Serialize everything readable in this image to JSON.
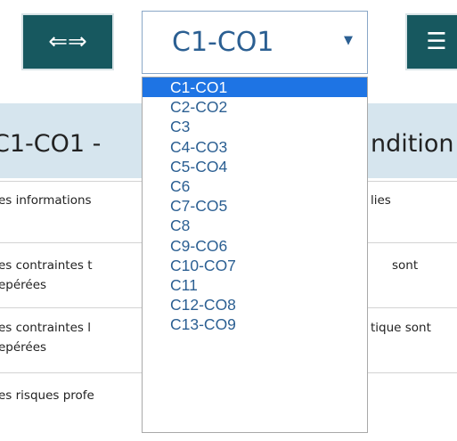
{
  "toolbar": {
    "swap_icon": "⇐⇒",
    "menu_icon": "☰"
  },
  "select": {
    "value": "C1-CO1",
    "caret": "▼"
  },
  "dropdown": {
    "options": [
      "C1-CO1",
      "C2-CO2",
      "C3",
      "C4-CO3",
      "C5-CO4",
      "C6",
      "C7-CO5",
      "C8",
      "C9-CO6",
      "C10-CO7",
      "C11",
      "C12-CO8",
      "C13-CO9"
    ]
  },
  "page": {
    "title_left": "C1-CO1 -",
    "title_right": "ndition",
    "rows": [
      {
        "left": "es informations",
        "right": "lies"
      },
      {
        "left": "es contraintes t",
        "left2": "epérées",
        "right": "sont"
      },
      {
        "left": "es contraintes l",
        "left2": "epérées",
        "right": "tique sont"
      },
      {
        "left": "es risques profe"
      }
    ]
  },
  "colors": {
    "teal": "#17585f",
    "accent": "#1e74e4",
    "link": "#2b5f92"
  }
}
